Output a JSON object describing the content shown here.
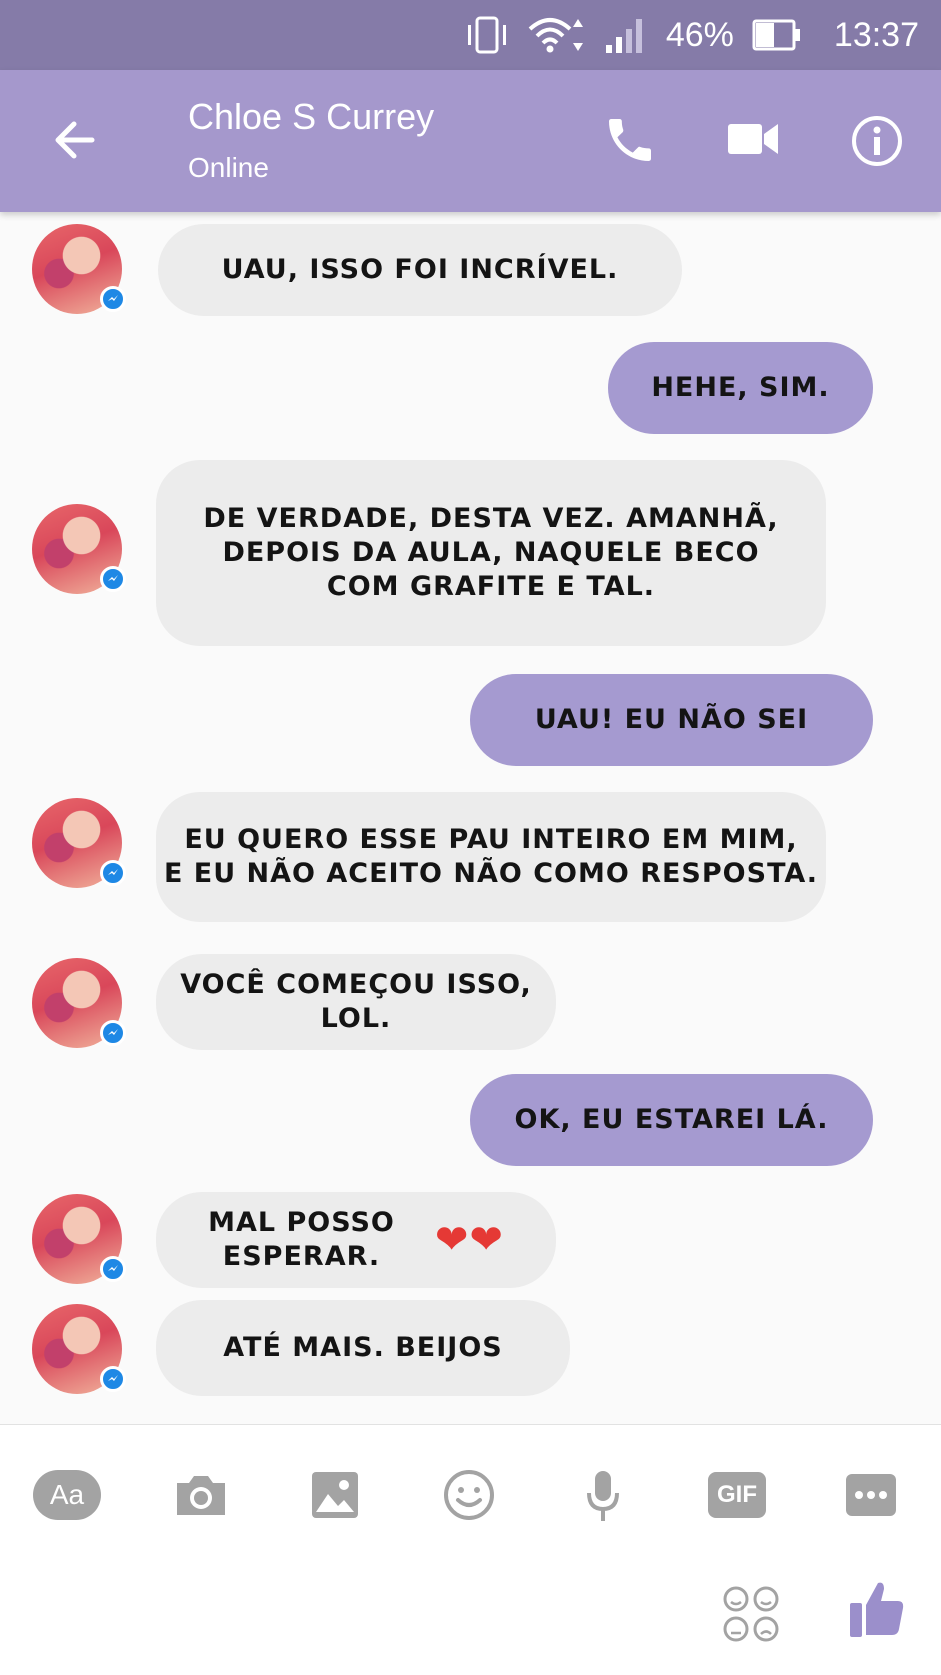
{
  "status_bar": {
    "battery": "46%",
    "time": "13:37"
  },
  "header": {
    "contact_name": "Chloe S Currey",
    "contact_status": "Online"
  },
  "messages": [
    {
      "sender": "contact",
      "text": "UAU, ISSO FOI INCRÍVEL."
    },
    {
      "sender": "me",
      "text": "HEHE, SIM."
    },
    {
      "sender": "contact",
      "text": "DE VERDADE, DESTA VEZ. AMANHÃ,\nDEPOIS DA AULA, NAQUELE BECO\nCOM GRAFITE E TAL."
    },
    {
      "sender": "me",
      "text": "UAU! EU NÃO SEI"
    },
    {
      "sender": "contact",
      "text": "EU QUERO ESSE PAU INTEIRO EM MIM,\nE EU NÃO ACEITO NÃO COMO RESPOSTA."
    },
    {
      "sender": "contact",
      "text": "VOCÊ COMEÇOU ISSO,\nLOL."
    },
    {
      "sender": "me",
      "text": "OK, EU ESTAREI LÁ."
    },
    {
      "sender": "contact",
      "text": "MAL POSSO\nESPERAR.",
      "emoji": "❤❤"
    },
    {
      "sender": "contact",
      "text": "ATÉ MAIS. BEIJOS"
    }
  ],
  "composer": {
    "text_button": "Aa",
    "gif_button": "GIF"
  },
  "colors": {
    "status_bar": "#857ba8",
    "header": "#a598cc",
    "outgoing_bubble": "#a59ad0",
    "incoming_bubble": "#ececec",
    "like": "#9b8fcb"
  },
  "icons": [
    "wifi-icon",
    "signal-icon",
    "battery-icon",
    "vibrate-icon",
    "back-arrow-icon",
    "phone-icon",
    "video-camera-icon",
    "info-icon",
    "camera-icon",
    "image-icon",
    "emoji-icon",
    "microphone-icon",
    "more-icon",
    "stickers-icon",
    "thumbs-up-icon",
    "messenger-badge-icon"
  ]
}
